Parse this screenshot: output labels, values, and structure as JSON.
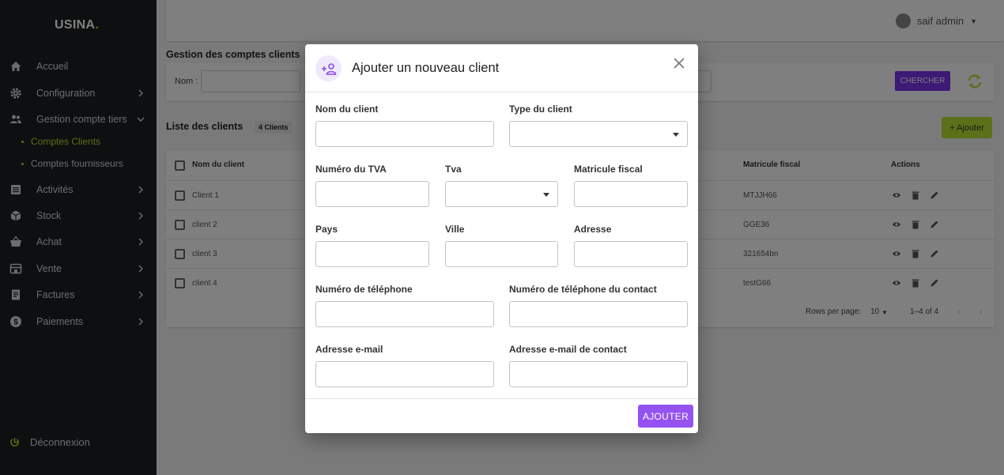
{
  "sidebar": {
    "brand": "USINA",
    "brand_dot": ".",
    "items": [
      {
        "label": "Accueil",
        "icon": "home-icon"
      },
      {
        "label": "Configuration",
        "icon": "gear-icon"
      },
      {
        "label": "Gestion compte tiers",
        "icon": "people-icon"
      },
      {
        "label": "Activités",
        "icon": "list-icon"
      },
      {
        "label": "Stock",
        "icon": "cube-icon"
      },
      {
        "label": "Achat",
        "icon": "basket-icon"
      },
      {
        "label": "Vente",
        "icon": "store-icon"
      },
      {
        "label": "Factures",
        "icon": "receipt-icon"
      },
      {
        "label": "Paiements",
        "icon": "dollar-icon"
      }
    ],
    "sub_items": [
      {
        "label": "Comptes Clients"
      },
      {
        "label": "Comptes fournisseurs"
      }
    ],
    "logout": "Déconnexion"
  },
  "topbar": {
    "user_name": "saif admin"
  },
  "page": {
    "section_title": "Gestion des comptes clients",
    "search_label": "Nom :",
    "search_button": "CHERCHER",
    "list_title": "Liste des clients",
    "count_badge": "4 Clients",
    "add_button": "+ Ajouter"
  },
  "table": {
    "headers": [
      "Nom du client",
      "Matricule fiscal",
      "Actions"
    ],
    "rows": [
      {
        "name": "Client 1",
        "matricule": "MTJJH66"
      },
      {
        "name": "client 2",
        "matricule": "GGE36"
      },
      {
        "name": "client 3",
        "matricule": "321654bn"
      },
      {
        "name": "client 4",
        "matricule": "testG66"
      }
    ],
    "rows_per_page_label": "Rows per page:",
    "rows_per_page": "10",
    "range": "1–4 of 4"
  },
  "dialog": {
    "title": "Ajouter un nouveau client",
    "labels": {
      "nom": "Nom du client",
      "type": "Type du client",
      "tva_num": "Numéro du TVA",
      "tva": "Tva",
      "matricule": "Matricule fiscal",
      "pays": "Pays",
      "ville": "Ville",
      "adresse": "Adresse",
      "tel": "Numéro de téléphone",
      "tel_contact": "Numéro de téléphone du contact",
      "email": "Adresse e-mail",
      "email_contact": "Adresse e-mail de contact"
    },
    "submit": "AJOUTER"
  },
  "colors": {
    "sidebar_bg": "#1c1e21",
    "accent_green": "#b7e031",
    "accent_purple": "#9452f1"
  }
}
